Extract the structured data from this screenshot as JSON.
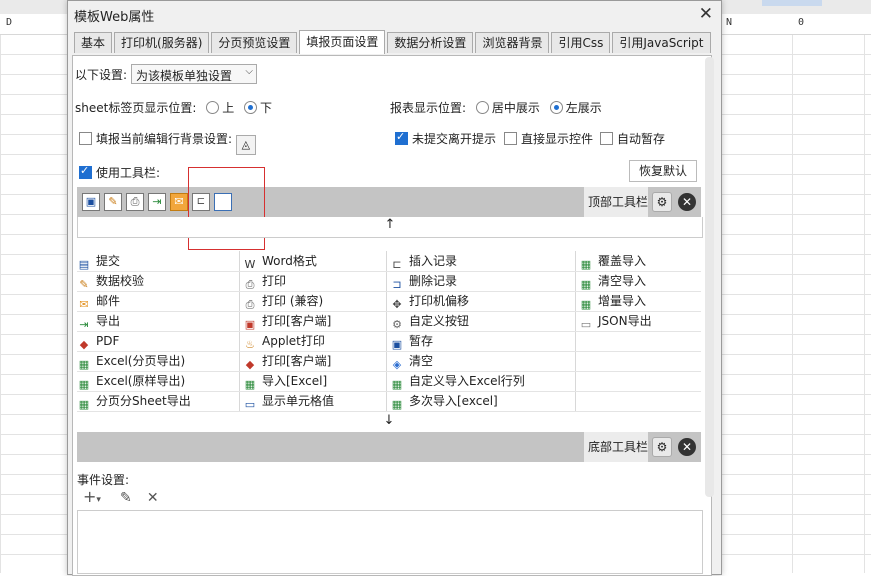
{
  "sheet": {
    "col_d": "D",
    "col_n": "N",
    "cell_value": "0"
  },
  "dialog": {
    "title": "模板Web属性",
    "tabs": [
      {
        "label": "基本"
      },
      {
        "label": "打印机(服务器)"
      },
      {
        "label": "分页预览设置"
      },
      {
        "label": "填报页面设置",
        "active": true
      },
      {
        "label": "数据分析设置"
      },
      {
        "label": "浏览器背景"
      },
      {
        "label": "引用Css"
      },
      {
        "label": "引用JavaScript"
      }
    ]
  },
  "settings": {
    "setting_label": "以下设置:",
    "setting_select": "为该模板单独设置",
    "sheet_tab_label": "sheet标签页显示位置:",
    "sheet_tab_opt1": "上",
    "sheet_tab_opt2": "下",
    "sheet_tab_selected": "下",
    "report_pos_label": "报表显示位置:",
    "report_pos_opt1": "居中展示",
    "report_pos_opt2": "左展示",
    "report_pos_selected": "左展示",
    "edit_row_bg_label": "填报当前编辑行背景设置:",
    "edit_row_bg_checked": false,
    "unsubmitted_label": "未提交离开提示",
    "unsubmitted_checked": true,
    "direct_show_label": "直接显示控件",
    "direct_show_checked": false,
    "auto_save_label": "自动暂存",
    "auto_save_checked": false,
    "use_toolbar_label": "使用工具栏:",
    "use_toolbar_checked": true,
    "restore_default": "恢复默认"
  },
  "top_toolbar": {
    "label": "顶部工具栏",
    "icons": [
      "save-icon",
      "validate-icon",
      "print-icon",
      "export-icon",
      "mail-icon",
      "insert-record-icon",
      "blank-icon"
    ]
  },
  "bottom_toolbar": {
    "label": "底部工具栏"
  },
  "up_arrow": "↑",
  "down_arrow": "↓",
  "buttons": [
    [
      "提交",
      "Word格式",
      "插入记录",
      "覆盖导入"
    ],
    [
      "数据校验",
      "打印",
      "删除记录",
      "清空导入"
    ],
    [
      "邮件",
      "打印 (兼容)",
      "打印机偏移",
      "增量导入"
    ],
    [
      "导出",
      "打印[客户端]",
      "自定义按钮",
      "JSON导出"
    ],
    [
      "PDF",
      "Applet打印",
      "暂存",
      ""
    ],
    [
      "Excel(分页导出)",
      "打印[客户端]",
      "清空",
      ""
    ],
    [
      "Excel(原样导出)",
      "导入[Excel]",
      "自定义导入Excel行列",
      ""
    ],
    [
      "分页分Sheet导出",
      "显示单元格值",
      "多次导入[excel]",
      ""
    ]
  ],
  "button_icons": [
    [
      "submit-icon",
      "word-icon",
      "insert-record-icon",
      "excel-import-icon"
    ],
    [
      "validate-icon",
      "print-icon",
      "delete-record-icon",
      "excel-import-icon"
    ],
    [
      "mail-icon",
      "print-icon",
      "move-icon",
      "excel-import-icon"
    ],
    [
      "export-icon",
      "flash-print-icon",
      "gear-icon",
      "json-export-icon"
    ],
    [
      "pdf-icon",
      "applet-print-icon",
      "save-icon",
      ""
    ],
    [
      "excel-icon",
      "pdf-print-icon",
      "eraser-icon",
      ""
    ],
    [
      "excel-icon",
      "excel-icon",
      "excel-icon",
      ""
    ],
    [
      "excel-icon",
      "cell-value-icon",
      "excel-icon",
      ""
    ]
  ],
  "event": {
    "label": "事件设置:"
  }
}
